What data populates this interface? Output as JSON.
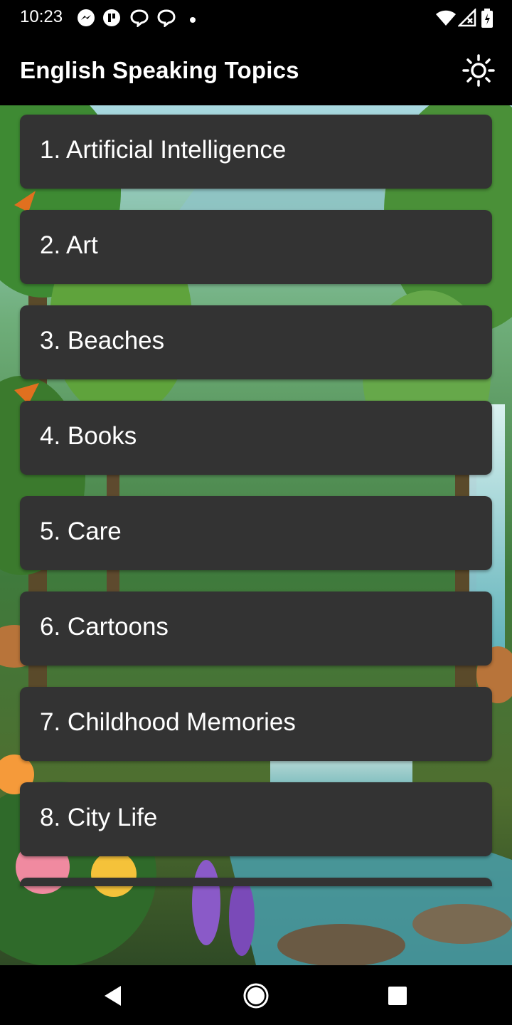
{
  "status_bar": {
    "time": "10:23",
    "icons": [
      "messenger-icon",
      "app-notification-icon",
      "chat-bubble-icon",
      "chat-bubble-icon",
      "dot-icon",
      "wifi-icon",
      "signal-icon",
      "battery-icon"
    ]
  },
  "app_bar": {
    "title": "English Speaking Topics",
    "theme_toggle_icon": "sun-icon"
  },
  "topics": [
    {
      "label": "1. Artificial Intelligence"
    },
    {
      "label": "2. Art"
    },
    {
      "label": "3. Beaches"
    },
    {
      "label": "4. Books"
    },
    {
      "label": "5. Care"
    },
    {
      "label": "6. Cartoons"
    },
    {
      "label": "7. Childhood Memories"
    },
    {
      "label": "8. City Life"
    },
    {
      "label": ""
    }
  ],
  "nav_bar": {
    "icons": [
      "back-icon",
      "home-icon",
      "recents-icon"
    ]
  },
  "colors": {
    "item_background": "#333333",
    "bar_background": "#000000",
    "text": "#ffffff"
  }
}
